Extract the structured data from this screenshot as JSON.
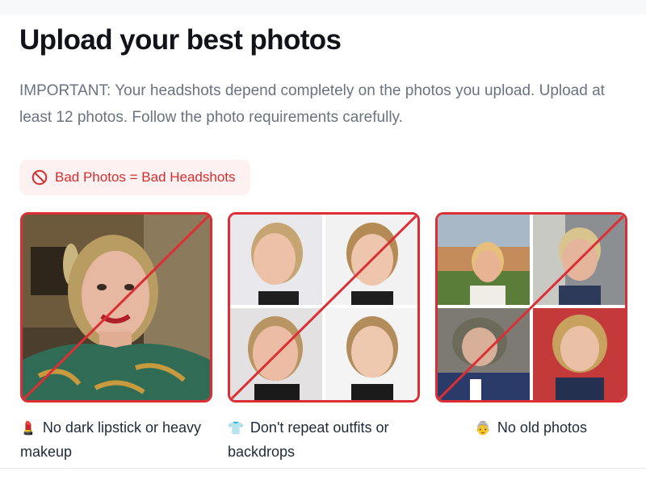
{
  "header": {
    "title": "Upload your best photos",
    "description": "IMPORTANT: Your headshots depend completely on the photos you upload. Upload at least 12 photos. Follow the photo requirements carefully."
  },
  "badge": {
    "label": "Bad Photos = Bad Headshots",
    "icon": "ban-icon",
    "color": "#d32f2f"
  },
  "examples": [
    {
      "caption": "No dark lipstick or heavy makeup",
      "emoji": "💄",
      "icon": "lipstick-icon"
    },
    {
      "caption": "Don't repeat outfits or backdrops",
      "emoji": "👕",
      "icon": "shirt-icon"
    },
    {
      "caption": "No old photos",
      "emoji": "👵",
      "icon": "old-person-icon"
    }
  ],
  "colors": {
    "accent_red": "#dc2f35",
    "text_primary": "#111318",
    "text_muted": "#6b7280"
  }
}
